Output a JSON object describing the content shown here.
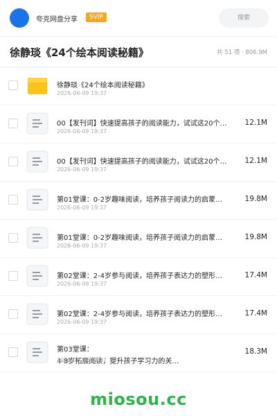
{
  "header": {
    "username": "夸克网盘分享",
    "badge": "SVIP",
    "search_placeholder": "搜索"
  },
  "folder": {
    "title": "徐静琰《24个绘本阅读秘籍》",
    "summary": "共 51 项 · 806.9M"
  },
  "files": [
    {
      "name": "徐静琰《24个绘本阅读秘籍》",
      "date": "2026-06-09 19:37",
      "size": "",
      "type": "folder"
    },
    {
      "name": "00【发刊词】快速提高孩子的阅读能力，试试这20个…",
      "date": "2026-06-09 19:37",
      "size": "12.1M",
      "type": "document"
    },
    {
      "name": "00【发刊词】快速提高孩子的阅读能力，试试这20个…",
      "date": "2026-06-09 19:37",
      "size": "12.1M",
      "type": "document"
    },
    {
      "name": "第01堂课：0-2岁趣味阅读，培养孩子阅读力的启蒙…",
      "date": "2026-06-09 19:37",
      "size": "19.8M",
      "type": "document"
    },
    {
      "name": "第01堂课：0-2岁趣味阅读，培养孩子阅读力的启蒙…",
      "date": "2026-06-09 19:37",
      "size": "19.8M",
      "type": "document"
    },
    {
      "name": "第02堂课：2-4岁参与阅读，培养孩子表达力的塑形…",
      "date": "2026-06-09 19:37",
      "size": "17.4M",
      "type": "document"
    },
    {
      "name": "第02堂课：2-4岁参与阅读，培养孩子表达力的塑形…",
      "date": "2026-06-09 19:37",
      "size": "17.4M",
      "type": "document"
    },
    {
      "name": "第03堂课：\n4-8岁拓展阅读，提升孩子学习力的关…",
      "date": "2026-06-09 19:37",
      "size": "18.3M",
      "type": "document"
    }
  ],
  "watermark": "miosou.cc",
  "colors": {
    "avatar": "#1a73e8",
    "badge": "#f5a623",
    "folder": "#fcc419",
    "watermark": "#2fb24c"
  }
}
